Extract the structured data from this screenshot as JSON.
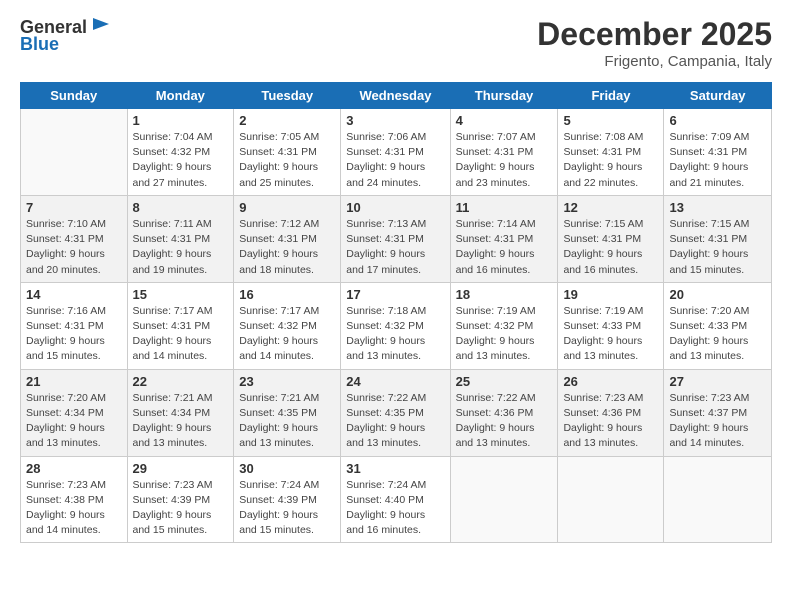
{
  "header": {
    "logo_general": "General",
    "logo_blue": "Blue",
    "main_title": "December 2025",
    "subtitle": "Frigento, Campania, Italy"
  },
  "days_of_week": [
    "Sunday",
    "Monday",
    "Tuesday",
    "Wednesday",
    "Thursday",
    "Friday",
    "Saturday"
  ],
  "weeks": [
    [
      {
        "day": "",
        "info": ""
      },
      {
        "day": "1",
        "info": "Sunrise: 7:04 AM\nSunset: 4:32 PM\nDaylight: 9 hours\nand 27 minutes."
      },
      {
        "day": "2",
        "info": "Sunrise: 7:05 AM\nSunset: 4:31 PM\nDaylight: 9 hours\nand 25 minutes."
      },
      {
        "day": "3",
        "info": "Sunrise: 7:06 AM\nSunset: 4:31 PM\nDaylight: 9 hours\nand 24 minutes."
      },
      {
        "day": "4",
        "info": "Sunrise: 7:07 AM\nSunset: 4:31 PM\nDaylight: 9 hours\nand 23 minutes."
      },
      {
        "day": "5",
        "info": "Sunrise: 7:08 AM\nSunset: 4:31 PM\nDaylight: 9 hours\nand 22 minutes."
      },
      {
        "day": "6",
        "info": "Sunrise: 7:09 AM\nSunset: 4:31 PM\nDaylight: 9 hours\nand 21 minutes."
      }
    ],
    [
      {
        "day": "7",
        "info": "Sunrise: 7:10 AM\nSunset: 4:31 PM\nDaylight: 9 hours\nand 20 minutes."
      },
      {
        "day": "8",
        "info": "Sunrise: 7:11 AM\nSunset: 4:31 PM\nDaylight: 9 hours\nand 19 minutes."
      },
      {
        "day": "9",
        "info": "Sunrise: 7:12 AM\nSunset: 4:31 PM\nDaylight: 9 hours\nand 18 minutes."
      },
      {
        "day": "10",
        "info": "Sunrise: 7:13 AM\nSunset: 4:31 PM\nDaylight: 9 hours\nand 17 minutes."
      },
      {
        "day": "11",
        "info": "Sunrise: 7:14 AM\nSunset: 4:31 PM\nDaylight: 9 hours\nand 16 minutes."
      },
      {
        "day": "12",
        "info": "Sunrise: 7:15 AM\nSunset: 4:31 PM\nDaylight: 9 hours\nand 16 minutes."
      },
      {
        "day": "13",
        "info": "Sunrise: 7:15 AM\nSunset: 4:31 PM\nDaylight: 9 hours\nand 15 minutes."
      }
    ],
    [
      {
        "day": "14",
        "info": "Sunrise: 7:16 AM\nSunset: 4:31 PM\nDaylight: 9 hours\nand 15 minutes."
      },
      {
        "day": "15",
        "info": "Sunrise: 7:17 AM\nSunset: 4:31 PM\nDaylight: 9 hours\nand 14 minutes."
      },
      {
        "day": "16",
        "info": "Sunrise: 7:17 AM\nSunset: 4:32 PM\nDaylight: 9 hours\nand 14 minutes."
      },
      {
        "day": "17",
        "info": "Sunrise: 7:18 AM\nSunset: 4:32 PM\nDaylight: 9 hours\nand 13 minutes."
      },
      {
        "day": "18",
        "info": "Sunrise: 7:19 AM\nSunset: 4:32 PM\nDaylight: 9 hours\nand 13 minutes."
      },
      {
        "day": "19",
        "info": "Sunrise: 7:19 AM\nSunset: 4:33 PM\nDaylight: 9 hours\nand 13 minutes."
      },
      {
        "day": "20",
        "info": "Sunrise: 7:20 AM\nSunset: 4:33 PM\nDaylight: 9 hours\nand 13 minutes."
      }
    ],
    [
      {
        "day": "21",
        "info": "Sunrise: 7:20 AM\nSunset: 4:34 PM\nDaylight: 9 hours\nand 13 minutes."
      },
      {
        "day": "22",
        "info": "Sunrise: 7:21 AM\nSunset: 4:34 PM\nDaylight: 9 hours\nand 13 minutes."
      },
      {
        "day": "23",
        "info": "Sunrise: 7:21 AM\nSunset: 4:35 PM\nDaylight: 9 hours\nand 13 minutes."
      },
      {
        "day": "24",
        "info": "Sunrise: 7:22 AM\nSunset: 4:35 PM\nDaylight: 9 hours\nand 13 minutes."
      },
      {
        "day": "25",
        "info": "Sunrise: 7:22 AM\nSunset: 4:36 PM\nDaylight: 9 hours\nand 13 minutes."
      },
      {
        "day": "26",
        "info": "Sunrise: 7:23 AM\nSunset: 4:36 PM\nDaylight: 9 hours\nand 13 minutes."
      },
      {
        "day": "27",
        "info": "Sunrise: 7:23 AM\nSunset: 4:37 PM\nDaylight: 9 hours\nand 14 minutes."
      }
    ],
    [
      {
        "day": "28",
        "info": "Sunrise: 7:23 AM\nSunset: 4:38 PM\nDaylight: 9 hours\nand 14 minutes."
      },
      {
        "day": "29",
        "info": "Sunrise: 7:23 AM\nSunset: 4:39 PM\nDaylight: 9 hours\nand 15 minutes."
      },
      {
        "day": "30",
        "info": "Sunrise: 7:24 AM\nSunset: 4:39 PM\nDaylight: 9 hours\nand 15 minutes."
      },
      {
        "day": "31",
        "info": "Sunrise: 7:24 AM\nSunset: 4:40 PM\nDaylight: 9 hours\nand 16 minutes."
      },
      {
        "day": "",
        "info": ""
      },
      {
        "day": "",
        "info": ""
      },
      {
        "day": "",
        "info": ""
      }
    ]
  ]
}
